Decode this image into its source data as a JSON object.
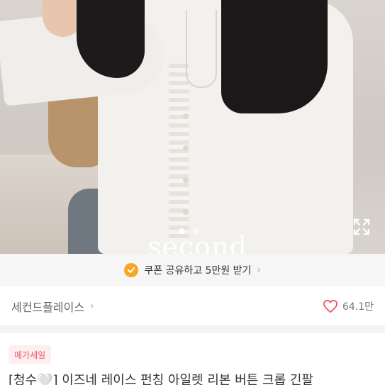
{
  "hero": {
    "watermark": "second",
    "slide_dots": 2,
    "active_slide": 1
  },
  "coupon": {
    "text": "쿠폰 공유하고 5만원 받기",
    "chevron": "›",
    "icon": "coupon-coin-icon",
    "accent_color": "#f6a623"
  },
  "seller": {
    "name": "세컨드플레이스",
    "chevron": "›",
    "likes": "64.1만",
    "like_icon": "heart-outline-icon",
    "like_color": "#e65a6c"
  },
  "product": {
    "badge": "메가세일",
    "title": "[청수🤍] 이즈네 레이스 펀칭 아일렛 리본 버튼 크롭 긴팔"
  }
}
